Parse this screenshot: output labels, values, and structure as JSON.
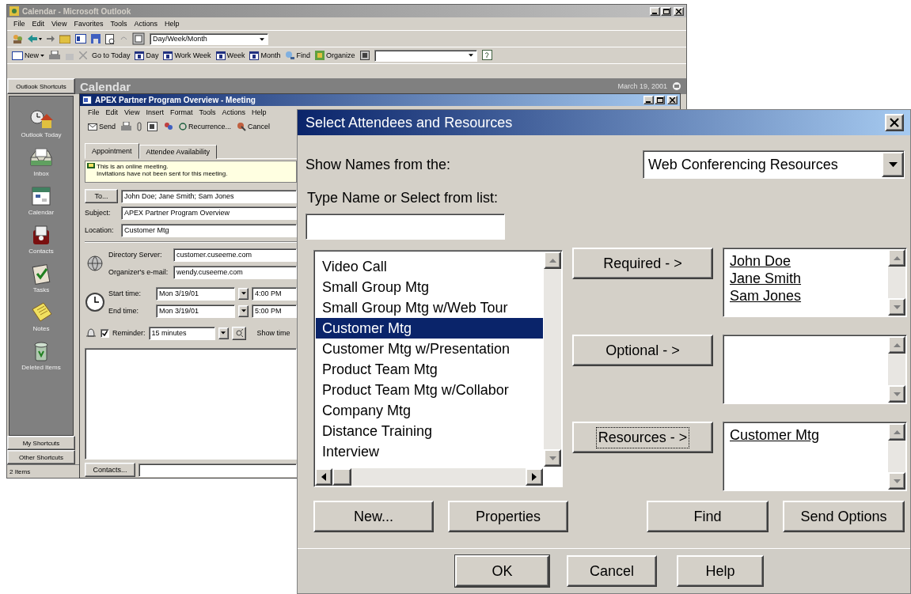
{
  "outlook": {
    "title": "Calendar - Microsoft Outlook",
    "menu": [
      "File",
      "Edit",
      "View",
      "Favorites",
      "Tools",
      "Actions",
      "Help"
    ],
    "view_combo": "Day/Week/Month",
    "toolbar": {
      "new": "New",
      "go_to_today": "Go to Today",
      "views": [
        "Day",
        "Work Week",
        "Week",
        "Month"
      ],
      "find": "Find",
      "organize": "Organize"
    },
    "shortcuts_title": "Outlook Shortcuts",
    "folder": "Calendar",
    "date": "March 19, 2001",
    "shortcuts": [
      "Outlook Today",
      "Inbox",
      "Calendar",
      "Contacts",
      "Tasks",
      "Notes",
      "Deleted Items"
    ],
    "groups": [
      "My Shortcuts",
      "Other Shortcuts"
    ],
    "status": "2 Items"
  },
  "meeting": {
    "title": "APEX Partner Program Overview - Meeting",
    "menu": [
      "File",
      "Edit",
      "View",
      "Insert",
      "Format",
      "Tools",
      "Actions",
      "Help"
    ],
    "toolbar": {
      "send": "Send",
      "recurrence": "Recurrence...",
      "cancel": "Cancel"
    },
    "tabs": [
      {
        "label": "Appointment",
        "selected": true
      },
      {
        "label": "Attendee Availability",
        "selected": false
      }
    ],
    "info": [
      "This is an online meeting.",
      "Invitations have not been sent for this meeting."
    ],
    "to_button": "To...",
    "to": "John Doe; Jane Smith; Sam Jones",
    "fields": [
      {
        "label": "Subject:",
        "value": "APEX Partner Program Overview"
      },
      {
        "label": "Location:",
        "value": "Customer Mtg"
      }
    ],
    "online": [
      {
        "label": "Directory Server:",
        "value": "customer.cuseeme.com"
      },
      {
        "label": "Organizer's e-mail:",
        "value": "wendy.cuseeme.com"
      }
    ],
    "times": [
      {
        "label": "Start time:",
        "date": "Mon 3/19/01",
        "time": "4:00 PM"
      },
      {
        "label": "End time:",
        "date": "Mon 3/19/01",
        "time": "5:00 PM"
      }
    ],
    "reminder": {
      "checked": true,
      "label": "Reminder:",
      "value": "15 minutes"
    },
    "show_time": "Show time",
    "contacts_button": "Contacts..."
  },
  "dialog": {
    "title": "Select Attendees and Resources",
    "show_names_label": "Show Names from the:",
    "address_book": "Web Conferencing Resources",
    "type_name_label": "Type Name or Select from list:",
    "names": [
      {
        "label": "Video Call",
        "selected": false
      },
      {
        "label": "Small Group Mtg",
        "selected": false
      },
      {
        "label": "Small Group Mtg w/Web Tour",
        "selected": false
      },
      {
        "label": "Customer Mtg",
        "selected": true
      },
      {
        "label": "Customer Mtg w/Presentation",
        "selected": false
      },
      {
        "label": "Product Team Mtg",
        "selected": false
      },
      {
        "label": "Product Team Mtg w/Collabor",
        "selected": false
      },
      {
        "label": "Company Mtg",
        "selected": false
      },
      {
        "label": "Distance Training",
        "selected": false
      },
      {
        "label": "Interview",
        "selected": false
      }
    ],
    "transfers": [
      {
        "button": "Required - >",
        "focused": false,
        "entries": [
          "John Doe",
          "Jane Smith",
          "Sam Jones"
        ]
      },
      {
        "button": "Optional - >",
        "focused": false
      },
      {
        "button": "Resources - >",
        "focused": true,
        "entries": [
          "Customer Mtg"
        ]
      }
    ],
    "actions": [
      "New...",
      "Properties",
      "Find",
      "Send Options"
    ],
    "footer": [
      "OK",
      "Cancel",
      "Help"
    ]
  }
}
